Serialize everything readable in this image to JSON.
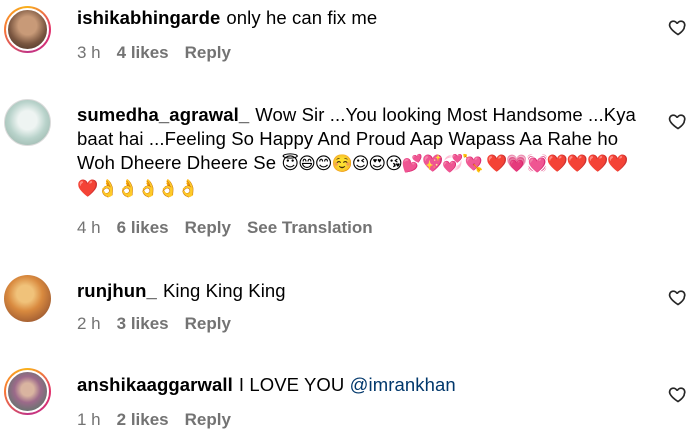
{
  "comments": [
    {
      "username": "ishikabhingarde",
      "text": "only he can fix me",
      "mention": "",
      "emojis": "",
      "time": "3 h",
      "likes": "4 likes",
      "reply": "Reply",
      "translation": "",
      "avatar_colors": [
        "#7a5640",
        "#c89a78"
      ]
    },
    {
      "username": "sumedha_agrawal_",
      "text": "Wow Sir ...You looking Most Handsome ...Kya baat hai ...Feeling So Happy And Proud Aap Wapass Aa Rahe ho Woh Dheere Dheere Se",
      "mention": "",
      "emojis": "😇😄😊☺️😉😍😘💕💖💞💘 ❤️💗💓❤️❤️❤️❤️❤️👌👌👌👌👌",
      "time": "4 h",
      "likes": "6 likes",
      "reply": "Reply",
      "translation": "See Translation",
      "avatar_colors": [
        "#cfe3dd",
        "#8faaa0"
      ]
    },
    {
      "username": "runjhun_",
      "text": "King King King",
      "mention": "",
      "emojis": "",
      "time": "2 h",
      "likes": "3 likes",
      "reply": "Reply",
      "translation": "",
      "avatar_colors": [
        "#d98a3f",
        "#7a3e2a"
      ]
    },
    {
      "username": "anshikaaggarwall",
      "text": "I LOVE YOU",
      "mention": "@imrankhan",
      "emojis": "",
      "time": "1 h",
      "likes": "2 likes",
      "reply": "Reply",
      "translation": "",
      "avatar_colors": [
        "#3f7b5a",
        "#9c6a8a"
      ]
    }
  ],
  "icons": {
    "like": "heart-outline-icon"
  }
}
